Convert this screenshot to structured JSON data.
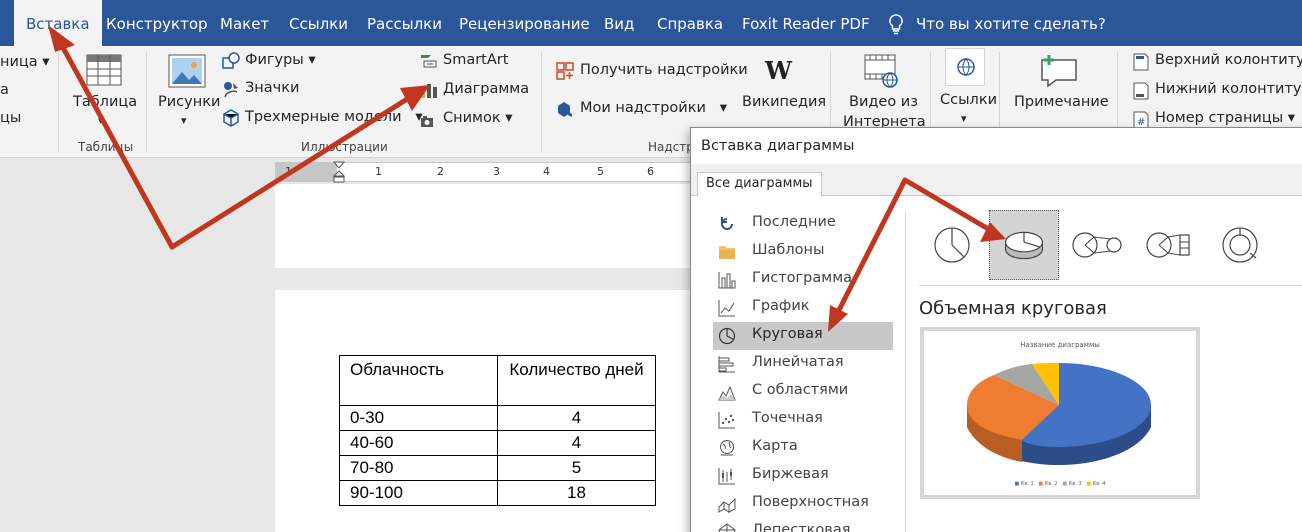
{
  "tabs": [
    {
      "label": "Вставка",
      "active": true
    },
    {
      "label": "Конструктор"
    },
    {
      "label": "Макет"
    },
    {
      "label": "Ссылки"
    },
    {
      "label": "Рассылки"
    },
    {
      "label": "Рецензирование"
    },
    {
      "label": "Вид"
    },
    {
      "label": "Справка"
    },
    {
      "label": "Foxit Reader PDF"
    }
  ],
  "tell_me": "Что вы хотите сделать?",
  "ribbon": {
    "cut_left": [
      "ница",
      "а",
      "цы"
    ],
    "tables": {
      "button": "Таблица",
      "caption": "Таблицы"
    },
    "illustrations": {
      "pictures": "Рисунки",
      "shapes": "Фигуры",
      "icons": "Значки",
      "models3d": "Трехмерные модели",
      "smartart": "SmartArt",
      "chart": "Диаграмма",
      "screenshot": "Снимок",
      "caption": "Иллюстрации"
    },
    "addins": {
      "get": "Получить надстройки",
      "my": "Мои надстройки",
      "wikipedia": "Википедия",
      "caption": "Надстр"
    },
    "media": {
      "video": "Видео из",
      "video2": "Интернета"
    },
    "links": {
      "label": "Ссылки"
    },
    "comments": {
      "label": "Примечание"
    },
    "header_footer": {
      "header": "Верхний колонтитул",
      "footer": "Нижний колонтитул",
      "page_number": "Номер страницы"
    }
  },
  "ruler": [
    "1",
    "1",
    "2",
    "3",
    "4",
    "5",
    "6"
  ],
  "table": {
    "headers": [
      "Облачность",
      "Количество дней"
    ],
    "rows": [
      [
        "0-30",
        "4"
      ],
      [
        "40-60",
        "4"
      ],
      [
        "70-80",
        "5"
      ],
      [
        "90-100",
        "18"
      ]
    ]
  },
  "dialog": {
    "title": "Вставка диаграммы",
    "tab": "Все диаграммы",
    "categories": [
      {
        "label": "Последние",
        "icon": "recent-icon"
      },
      {
        "label": "Шаблоны",
        "icon": "folder-icon"
      },
      {
        "label": "Гистограмма",
        "icon": "column-chart-icon"
      },
      {
        "label": "График",
        "icon": "line-chart-icon"
      },
      {
        "label": "Круговая",
        "icon": "pie-chart-icon",
        "selected": true
      },
      {
        "label": "Линейчатая",
        "icon": "bar-chart-icon"
      },
      {
        "label": "С областями",
        "icon": "area-chart-icon"
      },
      {
        "label": "Точечная",
        "icon": "scatter-chart-icon"
      },
      {
        "label": "Карта",
        "icon": "map-chart-icon"
      },
      {
        "label": "Биржевая",
        "icon": "stock-chart-icon"
      },
      {
        "label": "Поверхностная",
        "icon": "surface-chart-icon"
      },
      {
        "label": "Лепестковая",
        "icon": "radar-chart-icon"
      }
    ],
    "subtypes": [
      "pie",
      "pie-3d",
      "pie-of-pie",
      "bar-of-pie",
      "doughnut"
    ],
    "selected_subtype": "Объемная круговая",
    "preview": {
      "title": "Название диаграммы",
      "legend": [
        "Кв. 1",
        "Кв. 2",
        "Кв. 3",
        "Кв. 4"
      ]
    }
  },
  "colors": {
    "ribbon_blue": "#2b579a",
    "arrow": "#c0361f",
    "series": [
      "#4472c4",
      "#ed7d31",
      "#a5a5a5",
      "#ffc000"
    ]
  }
}
